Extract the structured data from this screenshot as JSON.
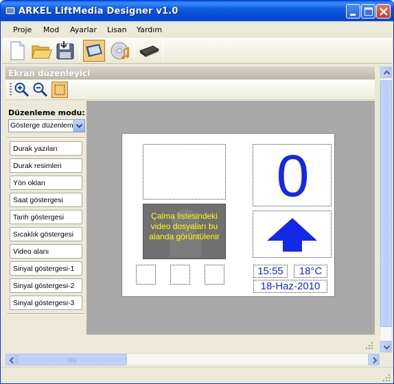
{
  "window": {
    "title": "ARKEL LiftMedia Designer v1.0"
  },
  "menu": {
    "items": [
      "Proje",
      "Mod",
      "Ayarlar",
      "Lisan",
      "Yardım"
    ]
  },
  "toolbar": {
    "tools": [
      "new-document-icon",
      "open-folder-icon",
      "save-disk-icon",
      "screen-editor-icon",
      "media-cd-icon",
      "memory-chip-icon"
    ],
    "active_tool": "screen-editor-icon"
  },
  "panel": {
    "title": "Ekran düzenleyici",
    "tools": [
      "zoom-in-icon",
      "zoom-out-icon",
      "select-rectangle-icon"
    ]
  },
  "side": {
    "mode_label": "Düzenleme modu:",
    "mode_value": "Gösterge düzenleme",
    "buttons": [
      "Durak yazıları",
      "Durak resimleri",
      "Yön okları",
      "Saat göstergesi",
      "Tarih göstergesi",
      "Sıcaklık göstergesi",
      "Video alanı",
      "Sinyal göstergesi-1",
      "Sinyal göstergesi-2",
      "Sinyal göstergesi-3"
    ]
  },
  "screen": {
    "video_text": "Çalma listesindeki video dosyaları bu alanda görüntülenir",
    "floor_number": "0",
    "direction": "up",
    "time": "15:55",
    "temperature": "18°C",
    "date": "18-Haz-2010",
    "colors": {
      "indicator_blue": "#1428e8",
      "video_text_yellow": "#ffff00",
      "video_bg": "#707070",
      "canvas_bg": "#a9a9a9"
    }
  }
}
